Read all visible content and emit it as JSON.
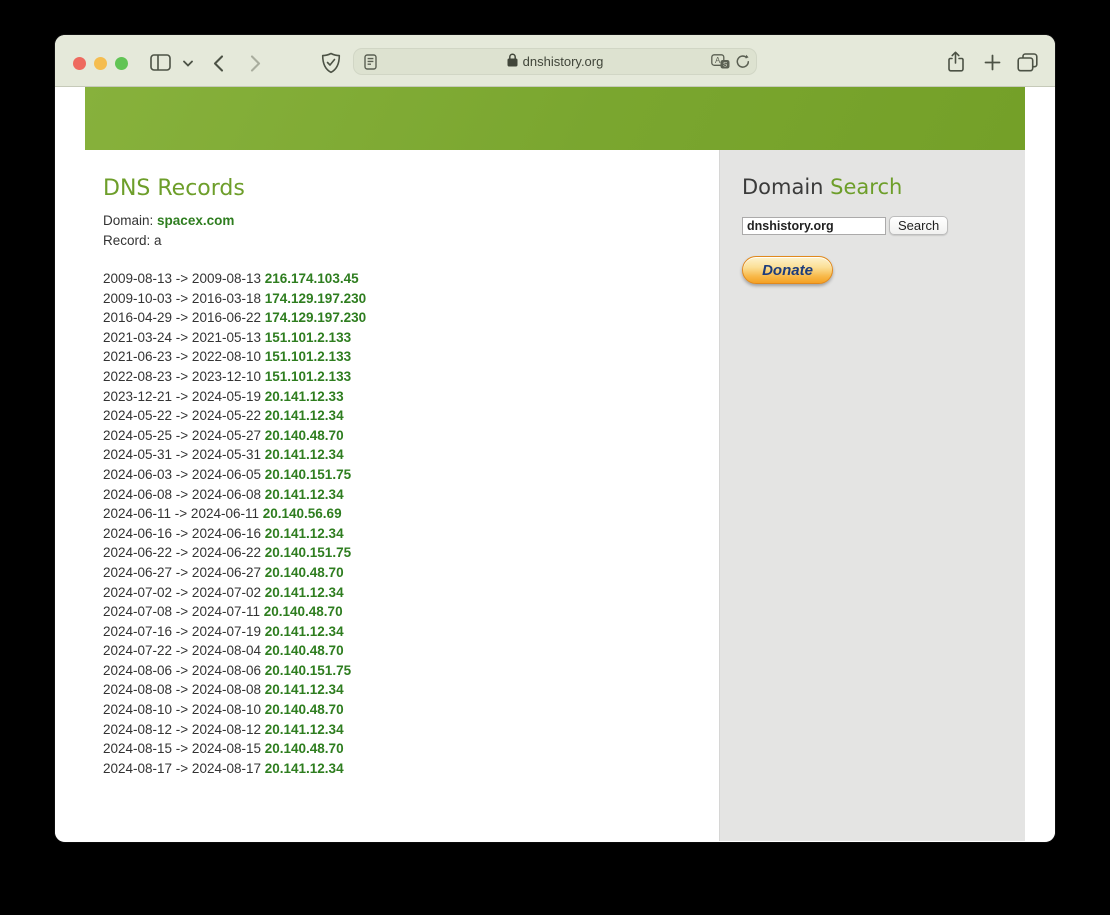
{
  "browser": {
    "url": "dnshistory.org",
    "icons": {
      "sidebar_toggle": "sidebar-toggle-icon",
      "chevron": "chevron-down-icon",
      "back": "back-arrow-icon",
      "forward": "forward-arrow-icon",
      "shield": "privacy-shield-icon",
      "reader": "reader-icon",
      "lock": "lock-icon",
      "translate": "translate-icon",
      "reload": "reload-icon",
      "share": "share-icon",
      "new_tab": "plus-icon",
      "tab_overview": "tabs-overview-icon"
    }
  },
  "main": {
    "title": "DNS Records",
    "domain_label": "Domain:",
    "domain_link": "spacex.com",
    "record_label": "Record:",
    "record_value": "a",
    "arrow": "->",
    "records": [
      {
        "start": "2009-08-13",
        "end": "2009-08-13",
        "ip": "216.174.103.45"
      },
      {
        "start": "2009-10-03",
        "end": "2016-03-18",
        "ip": "174.129.197.230"
      },
      {
        "start": "2016-04-29",
        "end": "2016-06-22",
        "ip": "174.129.197.230"
      },
      {
        "start": "2021-03-24",
        "end": "2021-05-13",
        "ip": "151.101.2.133"
      },
      {
        "start": "2021-06-23",
        "end": "2022-08-10",
        "ip": "151.101.2.133"
      },
      {
        "start": "2022-08-23",
        "end": "2023-12-10",
        "ip": "151.101.2.133"
      },
      {
        "start": "2023-12-21",
        "end": "2024-05-19",
        "ip": "20.141.12.33"
      },
      {
        "start": "2024-05-22",
        "end": "2024-05-22",
        "ip": "20.141.12.34"
      },
      {
        "start": "2024-05-25",
        "end": "2024-05-27",
        "ip": "20.140.48.70"
      },
      {
        "start": "2024-05-31",
        "end": "2024-05-31",
        "ip": "20.141.12.34"
      },
      {
        "start": "2024-06-03",
        "end": "2024-06-05",
        "ip": "20.140.151.75"
      },
      {
        "start": "2024-06-08",
        "end": "2024-06-08",
        "ip": "20.141.12.34"
      },
      {
        "start": "2024-06-11",
        "end": "2024-06-11",
        "ip": "20.140.56.69"
      },
      {
        "start": "2024-06-16",
        "end": "2024-06-16",
        "ip": "20.141.12.34"
      },
      {
        "start": "2024-06-22",
        "end": "2024-06-22",
        "ip": "20.140.151.75"
      },
      {
        "start": "2024-06-27",
        "end": "2024-06-27",
        "ip": "20.140.48.70"
      },
      {
        "start": "2024-07-02",
        "end": "2024-07-02",
        "ip": "20.141.12.34"
      },
      {
        "start": "2024-07-08",
        "end": "2024-07-11",
        "ip": "20.140.48.70"
      },
      {
        "start": "2024-07-16",
        "end": "2024-07-19",
        "ip": "20.141.12.34"
      },
      {
        "start": "2024-07-22",
        "end": "2024-08-04",
        "ip": "20.140.48.70"
      },
      {
        "start": "2024-08-06",
        "end": "2024-08-06",
        "ip": "20.140.151.75"
      },
      {
        "start": "2024-08-08",
        "end": "2024-08-08",
        "ip": "20.141.12.34"
      },
      {
        "start": "2024-08-10",
        "end": "2024-08-10",
        "ip": "20.140.48.70"
      },
      {
        "start": "2024-08-12",
        "end": "2024-08-12",
        "ip": "20.141.12.34"
      },
      {
        "start": "2024-08-15",
        "end": "2024-08-15",
        "ip": "20.140.48.70"
      },
      {
        "start": "2024-08-17",
        "end": "2024-08-17",
        "ip": "20.141.12.34"
      }
    ]
  },
  "sidebar": {
    "title_primary": "Domain ",
    "title_accent": "Search",
    "search_input_value": "dnshistory.org",
    "search_button_label": "Search",
    "donate_button_label": "Donate"
  },
  "colors": {
    "banner_green": "#7aa62f",
    "heading_green": "#6d9e2a",
    "link_green": "#2e7d1f",
    "toolbar_bg": "#e5e9da",
    "sidebar_bg": "#e4e4e3",
    "donate_text_blue": "#1d3c7c"
  }
}
